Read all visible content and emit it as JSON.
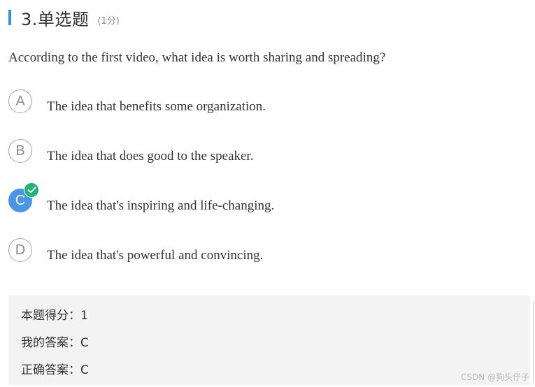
{
  "header": {
    "title": "3.单选题",
    "score": "(1分)"
  },
  "question": {
    "text": "According to the first video, what idea is worth sharing and spreading?"
  },
  "options": [
    {
      "letter": "A",
      "text": "The idea that benefits some organization.",
      "selected": false
    },
    {
      "letter": "B",
      "text": "The idea that does good to the speaker.",
      "selected": false
    },
    {
      "letter": "C",
      "text": "The idea that's inspiring and life-changing.",
      "selected": true,
      "correct": true
    },
    {
      "letter": "D",
      "text": "The idea that's powerful and convincing.",
      "selected": false
    }
  ],
  "result": {
    "score_label": "本题得分：",
    "score_value": "1",
    "my_answer_label": "我的答案：",
    "my_answer_value": "C",
    "correct_label": "正确答案：",
    "correct_value": "C"
  },
  "watermark": "CSDN @狗头仔子",
  "colors": {
    "accent": "#3a8ee6",
    "selected": "#4b94e8",
    "correct_badge": "#22b573",
    "result_bg": "#f3f3f3"
  }
}
